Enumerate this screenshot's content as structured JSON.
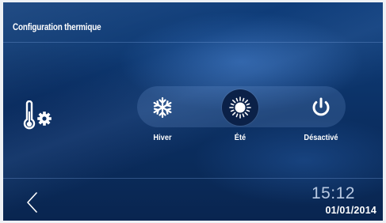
{
  "header": {
    "title": "Configuration thermique"
  },
  "modes": [
    {
      "id": "winter",
      "label": "Hiver",
      "icon": "snowflake-icon",
      "selected": false
    },
    {
      "id": "summer",
      "label": "Été",
      "icon": "sun-icon",
      "selected": true
    },
    {
      "id": "off",
      "label": "Désactivé",
      "icon": "power-icon",
      "selected": false
    }
  ],
  "status": {
    "time": "15:12",
    "date": "01/01/2014"
  },
  "icons": {
    "settings": "thermometer-gear-icon",
    "back": "chevron-left-icon"
  },
  "colors": {
    "background": "#0b2f62",
    "text": "#ffffff",
    "time_text": "#b8c9e2",
    "selected_bg": "#0b2148"
  }
}
